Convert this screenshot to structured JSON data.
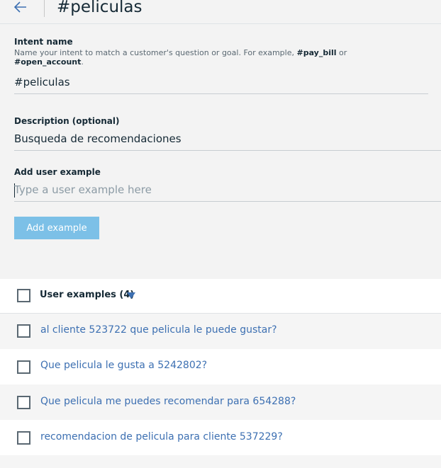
{
  "header": {
    "title": "#peliculas"
  },
  "intent_name": {
    "label": "Intent name",
    "help_prefix": "Name your intent to match a customer's question or goal. For example, ",
    "help_example1": "#pay_bill",
    "help_or": " or ",
    "help_example2": "#open_account",
    "help_end": ".",
    "value": "#peliculas"
  },
  "description": {
    "label": "Description (optional)",
    "value": "Busqueda de recomendaciones"
  },
  "user_example": {
    "label": "Add user example",
    "placeholder": "Type a user example here",
    "button_label": "Add example"
  },
  "examples": {
    "header_label": "User examples (4)",
    "items": [
      "al cliente 523722 que pelicula le puede gustar?",
      "Que pelicula le gusta a 5242802?",
      "Que pelicula me puedes recomendar para 654288?",
      "recomendacion de pelicula para cliente 537229?"
    ]
  },
  "colors": {
    "link": "#3d70b2",
    "button": "#7cc0e7",
    "text": "#152935"
  },
  "icons": {
    "back": "arrow-left-icon",
    "sort": "caret-down-icon"
  }
}
